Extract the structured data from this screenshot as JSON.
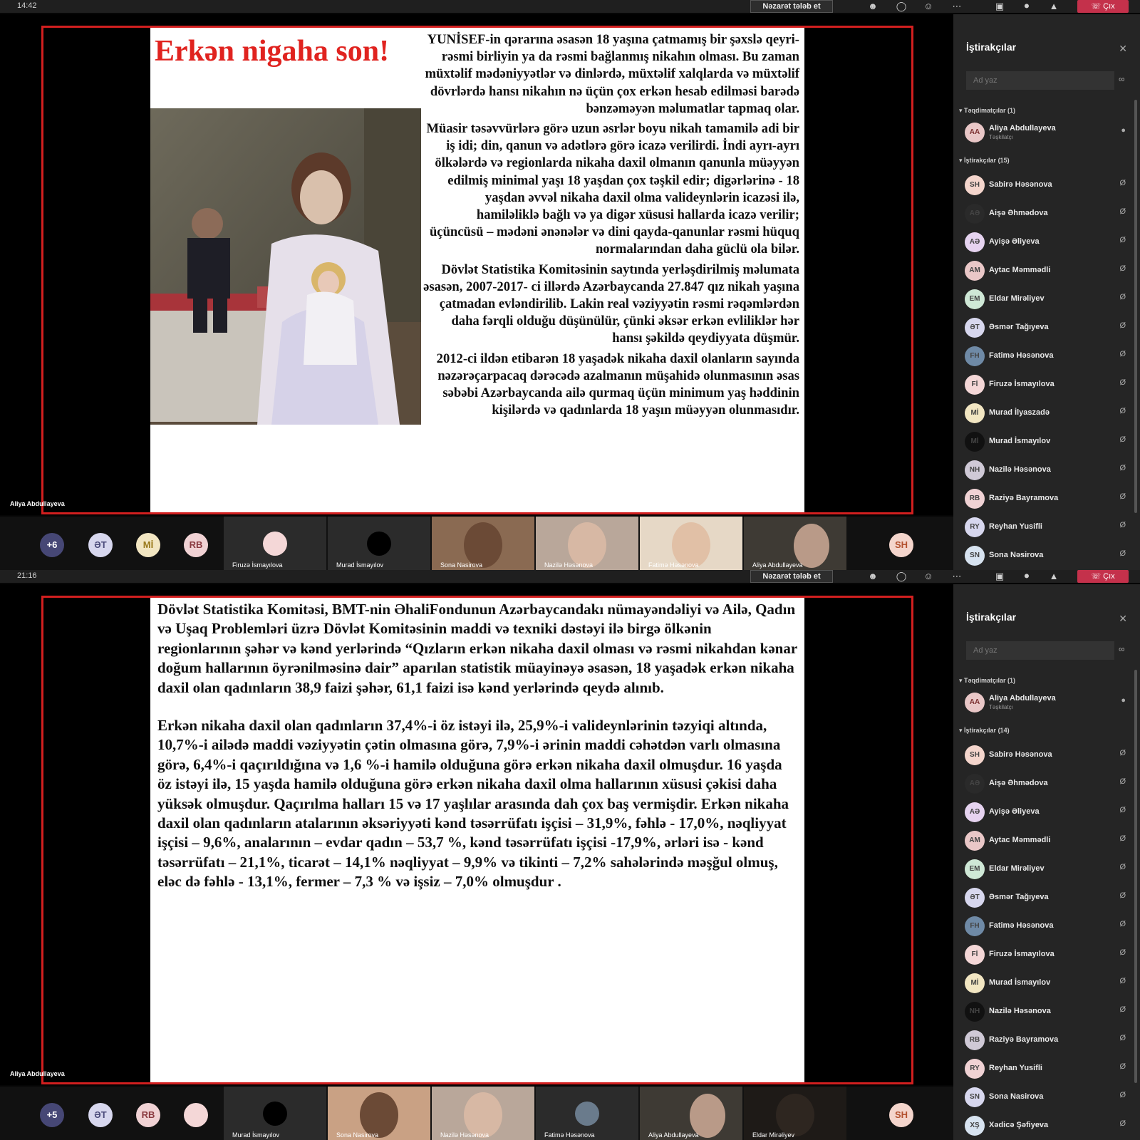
{
  "toolbar": {
    "request_control": "Nəzarət tələb et",
    "leave_label": "Çıx"
  },
  "shot1": {
    "clock": "14:42",
    "presenter_tag": "Aliya Abdullayeva",
    "slide": {
      "title": "Erkən nigaha son!",
      "paragraphs": [
        "YUNİSEF-in qərarına əsasən 18 yaşına çatmamış bir şəxslə qeyri-rəsmi birliyin ya da rəsmi bağlanmış nikahın olması. Bu zaman müxtəlif mədəniyyətlər və dinlərdə, müxtəlif xalqlarda və müxtəlif dövrlərdə hansı nikahın nə üçün çox erkən hesab edilməsi barədə bənzəməyən məlumatlar tapmaq olar.",
        "Müasir təsəvvürlərə görə uzun əsrlər boyu nikah tamamilə adi bir iş idi; din, qanun və adətlərə görə icazə verilirdi. İndi ayrı-ayrı ölkələrdə və regionlarda nikaha daxil olmanın qanunla müəyyən edilmiş minimal yaşı 18 yaşdan çox təşkil edir; digərlərinə - 18 yaşdan əvvəl nikaha daxil olma valideynlərin icazəsi ilə, hamiləliklə bağlı və ya digər xüsusi hallarda icazə verilir; üçüncüsü – mədəni ənənələr və dini qayda-qanunlar rəsmi hüquq normalarından daha güclü ola bilər.",
        "Dövlət Statistika Komitəsinin saytında yerləşdirilmiş məlumata əsasən, 2007-2017- ci illərdə Azərbaycanda 27.847 qız nikah yaşına çatmadan evləndirilib. Lakin real vəziyyətin rəsmi rəqəmlərdən daha fərqli olduğu düşünülür, çünki əksər erkən evliliklər hər hansı şəkildə qeydiyyata düşmür.",
        "2012-ci ildən etibarən 18 yaşadək nikaha daxil olanların sayında nəzərəçarpacaq dərəcədə azalmanın müşahidə olunmasının əsas səbəbi Azərbaycanda ailə qurmaq üçün minimum yaş həddinin kişilərdə və qadınlarda 18 yaşın müəyyən olunmasıdır."
      ]
    },
    "strip": {
      "overflow": "+6",
      "chips": [
        "ƏT",
        "Mİ",
        "RB"
      ],
      "tiles": [
        "Firuzə İsmayılova",
        "Murad İsmayılov",
        "Sona Nasirova",
        "Nazilə Həsənova",
        "Fatimə Həsənova",
        "Aliya Abdullayeva"
      ],
      "self": "SH"
    },
    "sidebar": {
      "title": "İştirakçılar",
      "search_placeholder": "Ad yaz",
      "presenters_header": "Təqdimatçılar (1)",
      "organizer": {
        "name": "Aliya Abdullayeva",
        "role": "Təşkilatçı",
        "initials": "AA"
      },
      "participants_header": "İştirakçılar (15)",
      "participants": [
        {
          "initials": "SH",
          "name": "Sabirə Həsənova"
        },
        {
          "initials": "AƏ",
          "name": "Aişə Əhmədova"
        },
        {
          "initials": "AƏ",
          "name": "Ayişə Əliyeva"
        },
        {
          "initials": "AM",
          "name": "Aytac Məmmədli"
        },
        {
          "initials": "EM",
          "name": "Eldar Mirəliyev"
        },
        {
          "initials": "ƏT",
          "name": "Əsmər Tağıyeva"
        },
        {
          "initials": "FH",
          "name": "Fatimə Həsənova"
        },
        {
          "initials": "Fİ",
          "name": "Firuzə İsmayılova"
        },
        {
          "initials": "Mİ",
          "name": "Murad İlyaszadə"
        },
        {
          "initials": "Mİ",
          "name": "Murad İsmayılov"
        },
        {
          "initials": "NH",
          "name": "Nazilə Həsənova"
        },
        {
          "initials": "RB",
          "name": "Raziyə Bayramova"
        },
        {
          "initials": "RY",
          "name": "Reyhan Yusifli"
        },
        {
          "initials": "SN",
          "name": "Sona Nəsirova"
        }
      ]
    }
  },
  "shot2": {
    "clock": "21:16",
    "presenter_tag": "Aliya Abdullayeva",
    "slide": {
      "paragraphs": [
        "Dövlət Statistika Komitəsi, BMT-nin ƏhaliFondunun Azərbaycandakı nümayəndəliyi və Ailə, Qadın və Uşaq Problemləri üzrə Dövlət Komitəsinin maddi və texniki dəstəyi ilə birgə ölkənin regionlarının şəhər və kənd yerlərində “Qızların erkən nikaha daxil olması və rəsmi nikahdan kənar doğum hallarının öyrənilməsinə dair” aparılan statistik müayinəyə əsasən, 18 yaşadək erkən nikaha daxil olan qadınların 38,9 faizi şəhər, 61,1 faizi isə kənd yerlərində qeydə alınıb.",
        "Erkən nikaha daxil olan qadınların 37,4%-i öz istəyi ilə, 25,9%-i valideynlərinin təzyiqi altında, 10,7%-i ailədə maddi vəziyyətin çətin olmasına görə, 7,9%-i ərinin maddi cəhətdən varlı olmasına görə, 6,4%-i qaçırıldığına və 1,6 %-i hamilə olduğuna görə erkən nikaha daxil olmuşdur. 16 yaşda öz istəyi ilə, 15 yaşda hamilə olduğuna görə erkən nikaha daxil olma hallarının xüsusi çəkisi daha yüksək olmuşdur. Qaçırılma halları 15 və 17 yaşlılar arasında dah çox baş vermişdir. Erkən nikaha daxil olan qadınların atalarının əksəriyyəti kənd təsərrüfatı işçisi – 31,9%, fəhlə - 17,0%, nəqliyyat işçisi – 9,6%, analarının – evdar qadın – 53,7 %, kənd təsərrüfatı işçisi -17,9%, ərləri isə - kənd təsərrüfatı – 21,1%, ticarət – 14,1% nəqliyyat – 9,9% və tikinti – 7,2% sahələrində məşğul olmuş, eləc də fəhlə - 13,1%, fermer – 7,3 % və işsiz – 7,0% olmuşdur ."
      ]
    },
    "strip": {
      "overflow": "+5",
      "chips": [
        "ƏT",
        "RB"
      ],
      "tiles": [
        "Murad İsmayılov",
        "Sona Nasirova",
        "Nazilə Həsənova",
        "Fatimə Həsənova",
        "Aliya Abdullayeva",
        "Eldar Mirəliyev"
      ],
      "self": "SH"
    },
    "sidebar": {
      "title": "İştirakçılar",
      "search_placeholder": "Ad yaz",
      "presenters_header": "Təqdimatçılar (1)",
      "organizer": {
        "name": "Aliya Abdullayeva",
        "role": "Təşkilatçı",
        "initials": "AA"
      },
      "participants_header": "İştirakçılar (14)",
      "participants": [
        {
          "initials": "SH",
          "name": "Sabirə Həsənova"
        },
        {
          "initials": "AƏ",
          "name": "Aişə Əhmədova"
        },
        {
          "initials": "AƏ",
          "name": "Ayişə Əliyeva"
        },
        {
          "initials": "AM",
          "name": "Aytac Məmmədli"
        },
        {
          "initials": "EM",
          "name": "Eldar Mirəliyev"
        },
        {
          "initials": "ƏT",
          "name": "Əsmər Tağıyeva"
        },
        {
          "initials": "FH",
          "name": "Fatimə Həsənova"
        },
        {
          "initials": "Fİ",
          "name": "Firuzə İsmayılova"
        },
        {
          "initials": "Mİ",
          "name": "Murad İsmayılov"
        },
        {
          "initials": "NH",
          "name": "Nazilə Həsənova"
        },
        {
          "initials": "RB",
          "name": "Raziyə Bayramova"
        },
        {
          "initials": "RY",
          "name": "Reyhan Yusifli"
        },
        {
          "initials": "SN",
          "name": "Sona Nasirova"
        },
        {
          "initials": "XŞ",
          "name": "Xədicə Şəfiyeva"
        }
      ]
    }
  }
}
